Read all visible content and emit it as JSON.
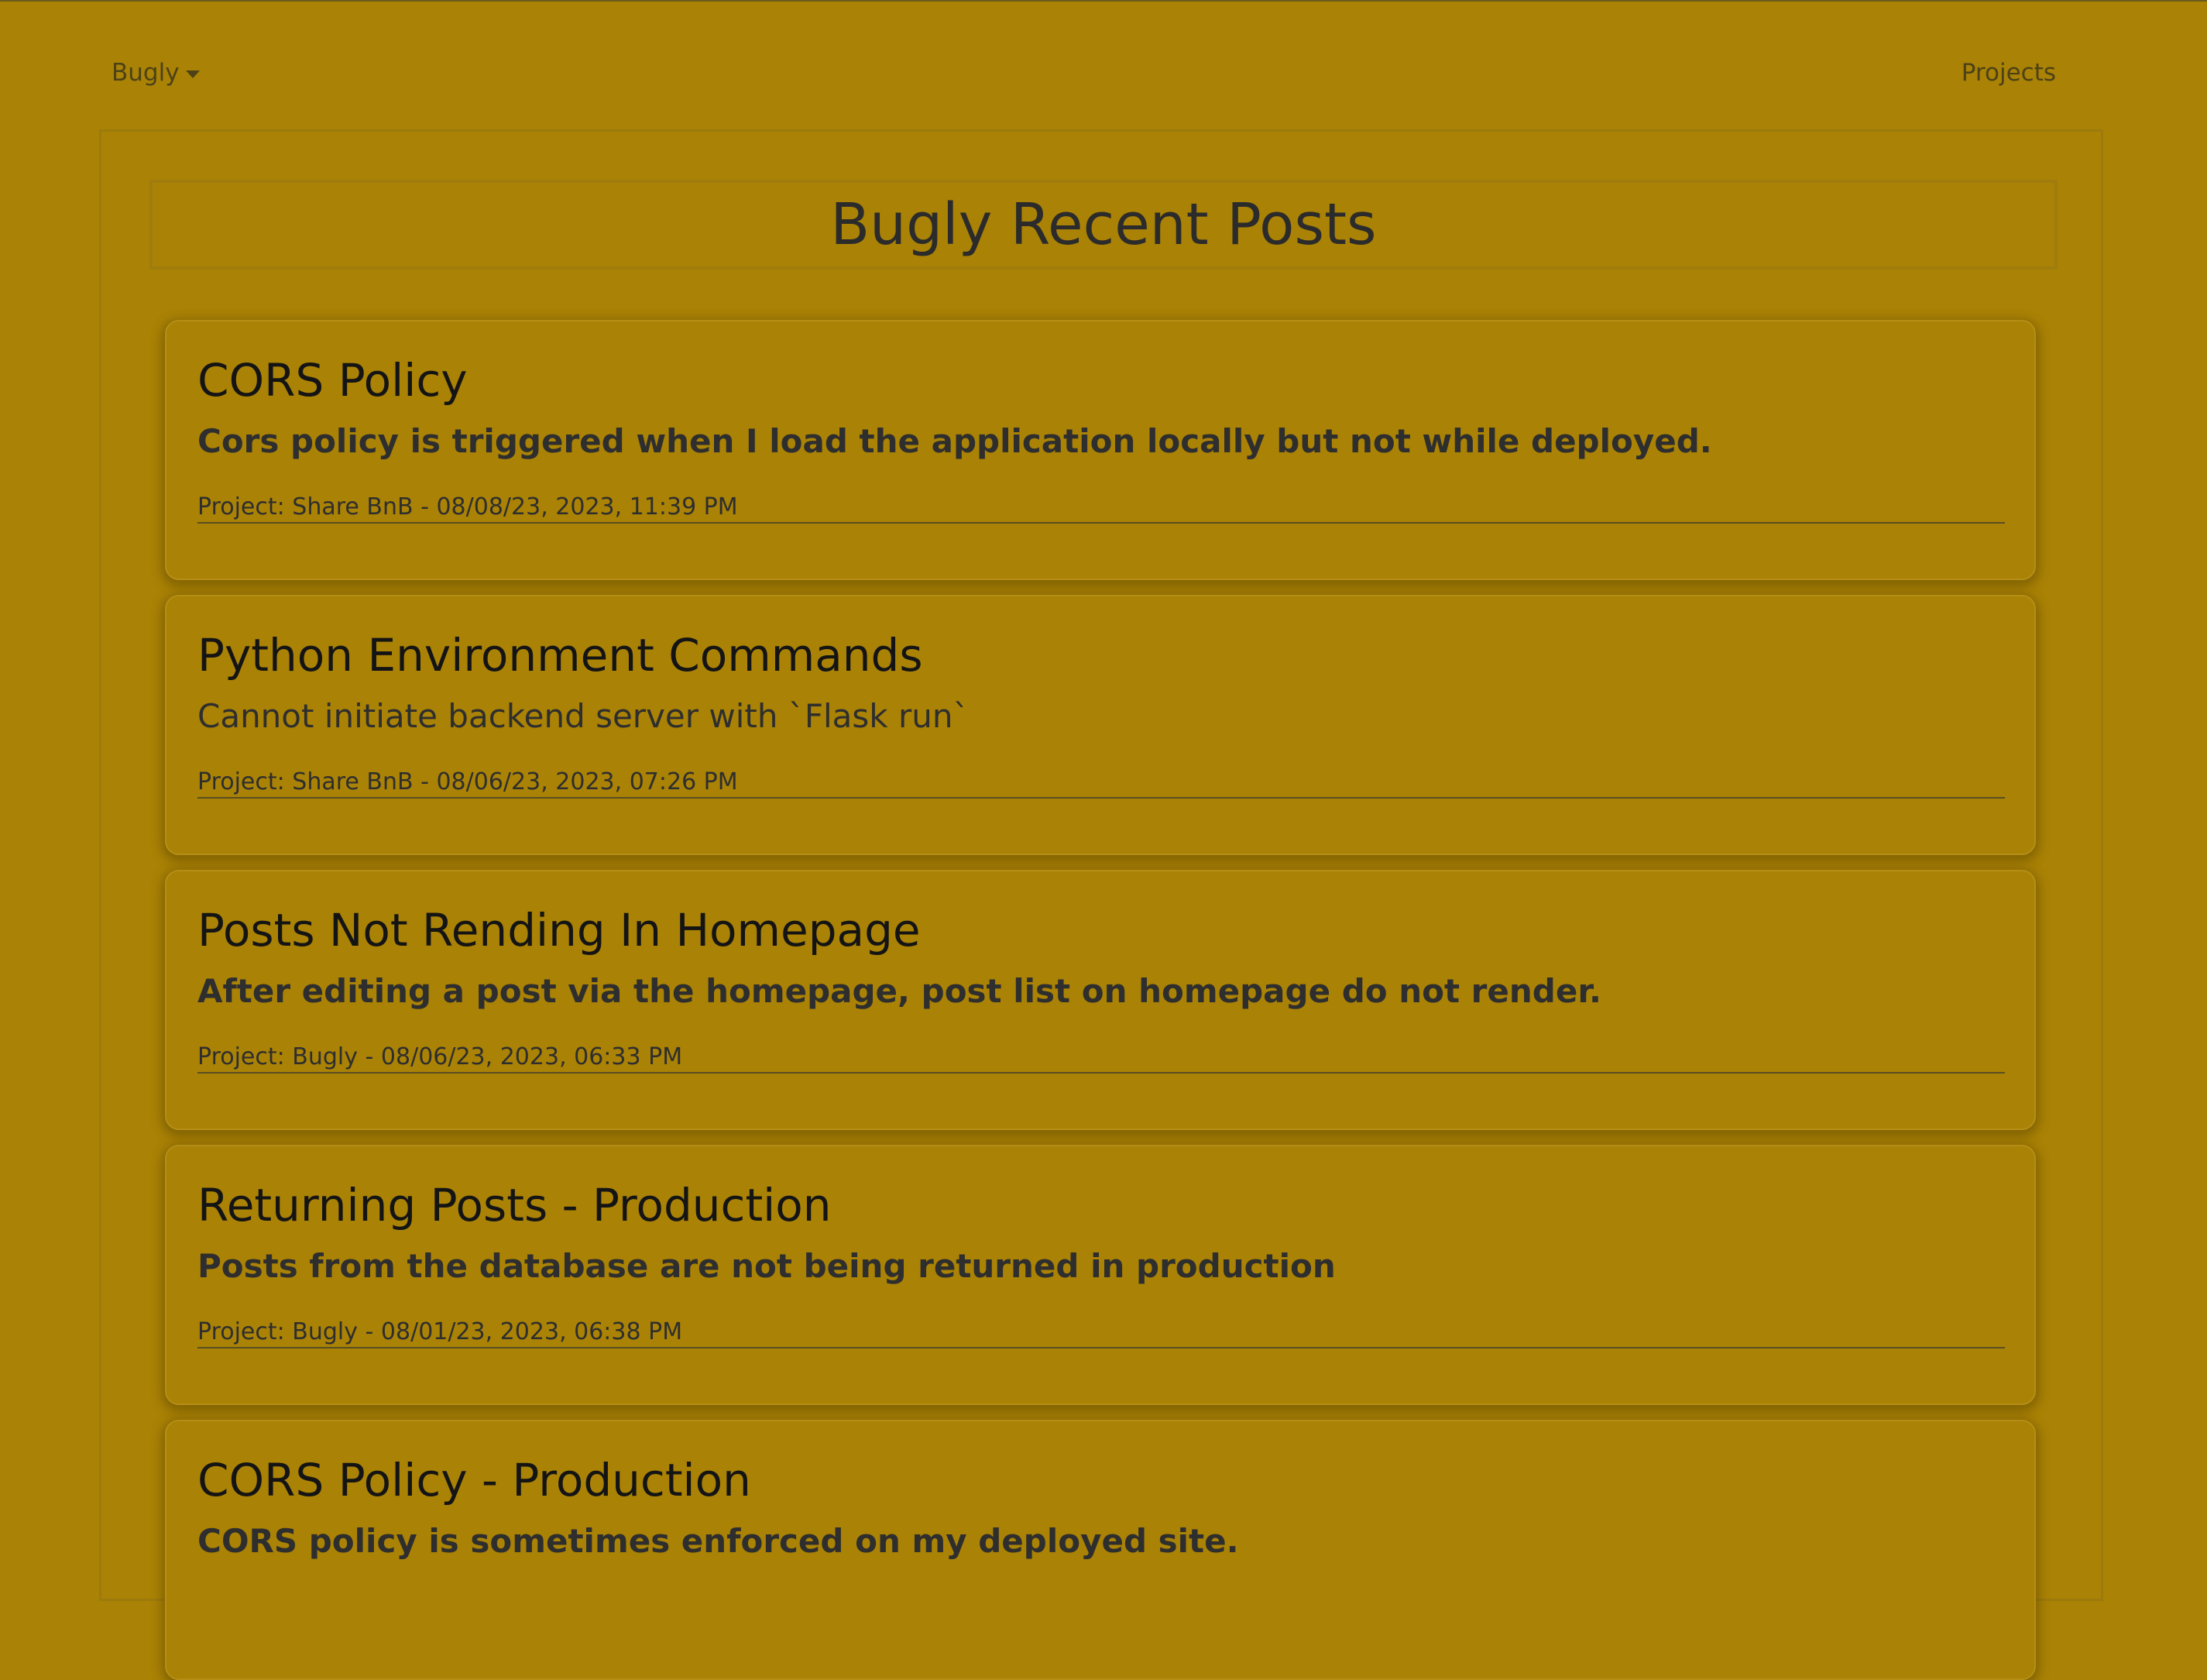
{
  "navbar": {
    "brand_label": "Bugly",
    "projects_link": "Projects"
  },
  "page": {
    "title": "Bugly Recent Posts"
  },
  "posts": [
    {
      "title": "CORS Policy",
      "description": "Cors policy is triggered when I load the application locally but not while deployed.",
      "meta": "Project: Share BnB - 08/08/23, 2023, 11:39 PM"
    },
    {
      "title": "Python Environment Commands",
      "description": "Cannot initiate backend server with `Flask run`",
      "meta": "Project: Share BnB - 08/06/23, 2023, 07:26 PM"
    },
    {
      "title": "Posts Not Rending In Homepage",
      "description": "After editing a post via the homepage, post list on homepage do not render.",
      "meta": "Project: Bugly - 08/06/23, 2023, 06:33 PM"
    },
    {
      "title": "Returning Posts - Production",
      "description": "Posts from the database are not being returned in production",
      "meta": "Project: Bugly - 08/01/23, 2023, 06:38 PM"
    },
    {
      "title": "CORS Policy - Production",
      "description": "CORS policy is sometimes enforced on my deployed site.",
      "meta": ""
    }
  ],
  "colors": {
    "background": "#aa8205",
    "text": "#2a2a2a",
    "title_text": "#141414"
  },
  "icons": {
    "brand_dropdown": "caret-down-icon"
  }
}
